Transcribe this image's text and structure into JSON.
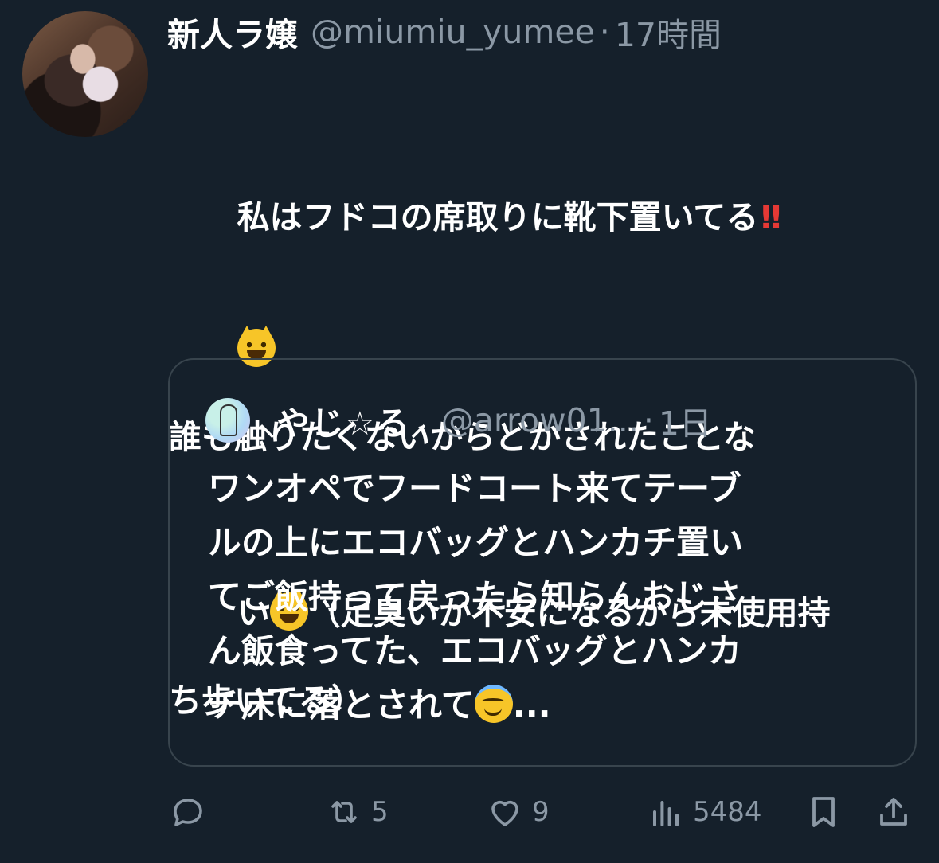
{
  "tweet": {
    "display_name": "新人ラ嬢",
    "handle": "@miumiu_yumee",
    "separator": "·",
    "time": "17時間",
    "body_lines": [
      "私はフドコの席取りに靴下置いてる",
      "",
      "誰も触りたくないからどかされたことな",
      "い",
      "（足臭いか不安になるから未使用持",
      "ち歩いてる）"
    ],
    "emoji_bang": "!!"
  },
  "quote": {
    "display_name": "⸜やじ☆る⸝",
    "handle": "@arrow01...",
    "separator": "·",
    "time": "1日",
    "text_lines": [
      "ワンオペでフードコート来てテーブ",
      "ルの上にエコバッグとハンカチ置い",
      "てご飯持って戻ったら知らんおじさ",
      "ん飯食ってた、エコバッグとハンカ",
      "チ床に落とされて"
    ],
    "ellipsis": "..."
  },
  "actions": {
    "reply_count": "",
    "retweet_count": "5",
    "like_count": "9",
    "views_count": "5484"
  },
  "icons": {
    "reply": "reply-icon",
    "retweet": "retweet-icon",
    "like": "heart-icon",
    "views": "views-icon",
    "bookmark": "bookmark-icon",
    "share": "share-icon"
  },
  "colors": {
    "background": "#15202b",
    "secondary_text": "#8b98a5",
    "border": "#38444d"
  }
}
